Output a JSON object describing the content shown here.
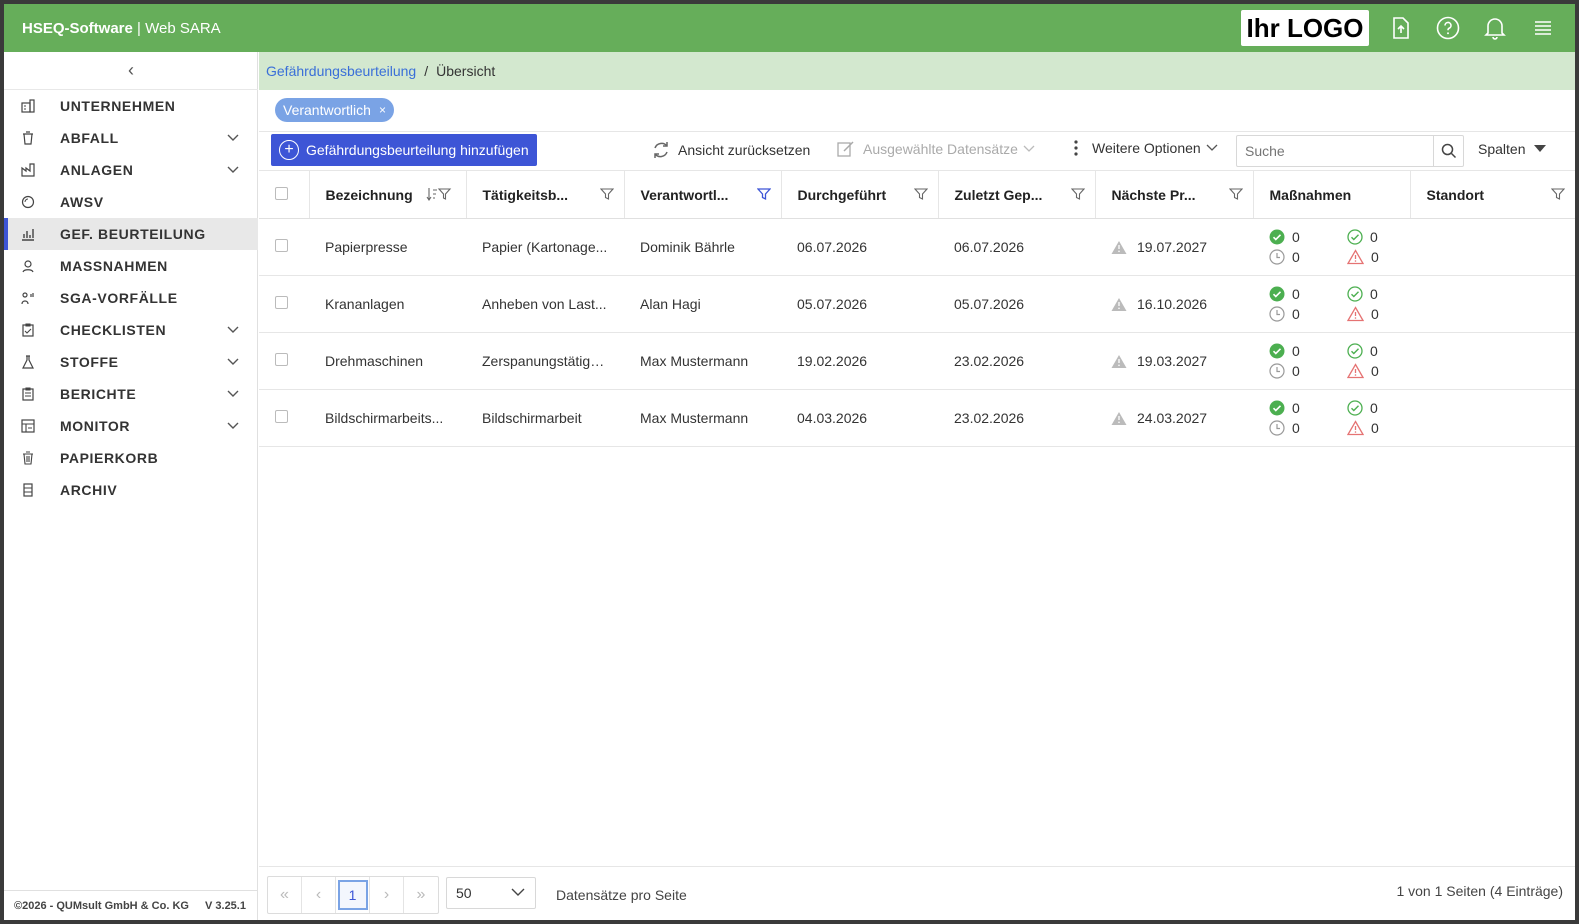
{
  "app": {
    "brand": "HSEQ-Software",
    "separator": " | ",
    "product": "Web SARA",
    "logo_text": "Ihr LOGO"
  },
  "topbar_icons": [
    "upload-icon",
    "help-icon",
    "bell-icon",
    "menu-icon"
  ],
  "sidebar": {
    "collapse_glyph": "‹",
    "items": [
      {
        "label": "UNTERNEHMEN",
        "icon": "building-icon",
        "expandable": false
      },
      {
        "label": "ABFALL",
        "icon": "trash-bin-icon",
        "expandable": true
      },
      {
        "label": "ANLAGEN",
        "icon": "factory-icon",
        "expandable": true
      },
      {
        "label": "AWSV",
        "icon": "drop-icon",
        "expandable": false
      },
      {
        "label": "GEF. BEURTEILUNG",
        "icon": "chart-icon",
        "expandable": false,
        "active": true
      },
      {
        "label": "MASSNAHMEN",
        "icon": "measures-icon",
        "expandable": false
      },
      {
        "label": "SGA-VORFÄLLE",
        "icon": "incident-icon",
        "expandable": false
      },
      {
        "label": "CHECKLISTEN",
        "icon": "clipboard-icon",
        "expandable": true
      },
      {
        "label": "STOFFE",
        "icon": "flask-icon",
        "expandable": true
      },
      {
        "label": "BERICHTE",
        "icon": "report-icon",
        "expandable": true
      },
      {
        "label": "MONITOR",
        "icon": "monitor-icon",
        "expandable": true
      },
      {
        "label": "PAPIERKORB",
        "icon": "trash-icon",
        "expandable": false
      },
      {
        "label": "ARCHIV",
        "icon": "archive-icon",
        "expandable": false
      }
    ],
    "footer_copyright": "©2026 - QUMsult GmbH & Co. KG",
    "footer_version": "V 3.25.1"
  },
  "breadcrumb": {
    "parent": "Gefährdungsbeurteilung",
    "separator": "/",
    "current": "Übersicht"
  },
  "filter_chip": {
    "label": "Verantwortlich",
    "close": "×"
  },
  "toolbar": {
    "add_label": "Gefährdungsbeurteilung hinzufügen",
    "reset_label": "Ansicht zurücksetzen",
    "selected_label": "Ausgewählte Datensätze",
    "more_label": "Weitere Optionen",
    "search_placeholder": "Suche",
    "columns_label": "Spalten"
  },
  "table": {
    "headers": [
      "Bezeichnung",
      "Tätigkeitsb...",
      "Verantwortl...",
      "Durchgeführt",
      "Zuletzt Gep...",
      "Nächste Pr...",
      "Maßnahmen",
      "Standort"
    ],
    "rows": [
      {
        "bezeichnung": "Papierpresse",
        "taetigkeit": "Papier (Kartonage...",
        "verantwortlich": "Dominik Bährle",
        "durchgefuehrt": "06.07.2026",
        "zuletzt": "06.07.2026",
        "naechste": "19.07.2027",
        "m_done": "0",
        "m_checked": "0",
        "m_pending": "0",
        "m_overdue": "0",
        "standort": ""
      },
      {
        "bezeichnung": "Krananlagen",
        "taetigkeit": "Anheben von Last...",
        "verantwortlich": "Alan Hagi",
        "durchgefuehrt": "05.07.2026",
        "zuletzt": "05.07.2026",
        "naechste": "16.10.2026",
        "m_done": "0",
        "m_checked": "0",
        "m_pending": "0",
        "m_overdue": "0",
        "standort": ""
      },
      {
        "bezeichnung": "Drehmaschinen",
        "taetigkeit": "Zerspanungstätigk...",
        "verantwortlich": "Max Mustermann",
        "durchgefuehrt": "19.02.2026",
        "zuletzt": "23.02.2026",
        "naechste": "19.03.2027",
        "m_done": "0",
        "m_checked": "0",
        "m_pending": "0",
        "m_overdue": "0",
        "standort": ""
      },
      {
        "bezeichnung": "Bildschirmarbeits...",
        "taetigkeit": "Bildschirmarbeit",
        "verantwortlich": "Max Mustermann",
        "durchgefuehrt": "04.03.2026",
        "zuletzt": "23.02.2026",
        "naechste": "24.03.2027",
        "m_done": "0",
        "m_checked": "0",
        "m_pending": "0",
        "m_overdue": "0",
        "standort": ""
      }
    ]
  },
  "pagination": {
    "first": "«",
    "prev": "‹",
    "current_page": "1",
    "next": "›",
    "last": "»",
    "page_size": "50",
    "per_page_label": "Datensätze pro Seite",
    "info": "1 von 1 Seiten (4 Einträge)"
  },
  "colors": {
    "topbar": "#66ae5a",
    "breadcrumb_bg": "#d3e8cf",
    "primary": "#3d55d6",
    "chip": "#7aa3e5",
    "done_green": "#4caf50",
    "overdue_red": "#e57373"
  }
}
